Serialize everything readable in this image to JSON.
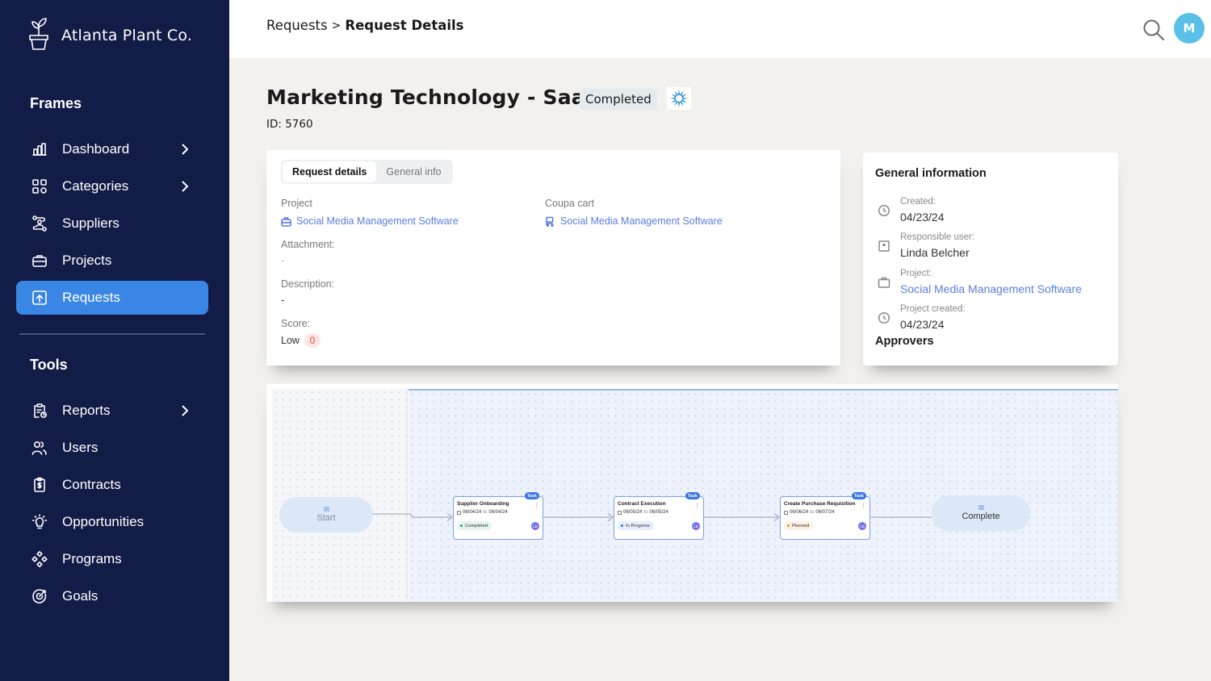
{
  "brand": {
    "name": "Atlanta Plant Co.",
    "icon": "potted-plant-icon"
  },
  "sidebar": {
    "frames_title": "Frames",
    "frames_items": [
      {
        "label": "Dashboard",
        "icon": "bar-chart-icon",
        "has_chevron": true,
        "active": false
      },
      {
        "label": "Categories",
        "icon": "grid-icon",
        "has_chevron": true,
        "active": false
      },
      {
        "label": "Suppliers",
        "icon": "supplier-route-icon",
        "has_chevron": false,
        "active": false
      },
      {
        "label": "Projects",
        "icon": "briefcase-icon",
        "has_chevron": false,
        "active": false
      },
      {
        "label": "Requests",
        "icon": "upload-box-icon",
        "has_chevron": false,
        "active": true
      }
    ],
    "tools_title": "Tools",
    "tools_items": [
      {
        "label": "Reports",
        "icon": "clipboard-clock-icon",
        "has_chevron": true
      },
      {
        "label": "Users",
        "icon": "users-icon",
        "has_chevron": false
      },
      {
        "label": "Contracts",
        "icon": "clipboard-dollar-icon",
        "has_chevron": false
      },
      {
        "label": "Opportunities",
        "icon": "lightbulb-icon",
        "has_chevron": false
      },
      {
        "label": "Programs",
        "icon": "diamond-dots-icon",
        "has_chevron": false
      },
      {
        "label": "Goals",
        "icon": "target-icon",
        "has_chevron": false
      }
    ],
    "colors": {
      "background": "#131b47",
      "active": "#3a86e4"
    }
  },
  "header": {
    "breadcrumb": {
      "parent": "Requests",
      "separator": ">",
      "current": "Request Details"
    },
    "search_icon": "search-icon",
    "avatar_initial": "M"
  },
  "request": {
    "title": "Marketing Technology - SaaS",
    "status": "Completed",
    "id_label": "ID: 5760"
  },
  "details": {
    "tabs": [
      {
        "label": "Request details",
        "active": true
      },
      {
        "label": "General info",
        "active": false
      }
    ],
    "project_label": "Project",
    "project_value": "Social Media Management Software",
    "coupa_label": "Coupa cart",
    "coupa_value": "Social Media Management Software",
    "attachment_label": "Attachment:",
    "attachment_value": "-",
    "description_label": "Description:",
    "description_value": "-",
    "score_label": "Score:",
    "score_level": "Low",
    "score_value": "0"
  },
  "general_info": {
    "title": "General information",
    "rows": [
      {
        "label": "Created:",
        "value": "04/23/24",
        "icon": "clock-icon",
        "link": false
      },
      {
        "label": "Responsible user:",
        "value": "Linda Belcher",
        "icon": "badge-icon",
        "link": false
      },
      {
        "label": "Project:",
        "value": "Social Media Management Software",
        "icon": "briefcase-icon",
        "link": true
      },
      {
        "label": "Project created:",
        "value": "04/23/24",
        "icon": "clock-icon",
        "link": false
      }
    ],
    "approvers_title": "Approvers"
  },
  "workflow": {
    "start_label": "Start",
    "complete_label": "Complete",
    "tasks": [
      {
        "tag": "Task",
        "title": "Supplier Onboarding",
        "start": "06/04/24",
        "to": "to",
        "end": "06/04/24",
        "status": "Completed",
        "status_color": "#2fa58a",
        "status_bg": "#e5f4ef",
        "assignee": "LB"
      },
      {
        "tag": "Task",
        "title": "Contract Execution",
        "start": "06/05/24",
        "to": "to",
        "end": "06/05/24",
        "status": "In Progress",
        "status_color": "#3c74e4",
        "status_bg": "#e6eefc",
        "assignee": "LB"
      },
      {
        "tag": "Task",
        "title": "Create Purchase Requisition",
        "start": "06/06/24",
        "to": "to",
        "end": "06/07/24",
        "status": "Planned",
        "status_color": "#f08a2c",
        "status_bg": "#fdf1e4",
        "assignee": "LB"
      }
    ]
  }
}
